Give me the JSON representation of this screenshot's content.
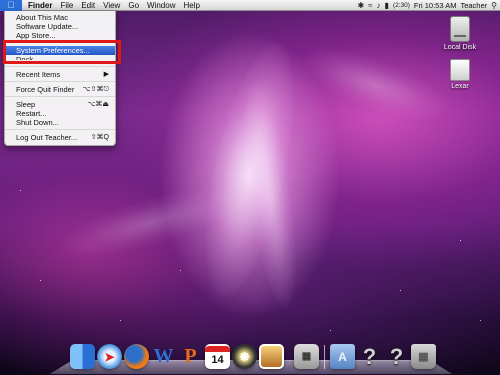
{
  "menubar": {
    "apple_icon": "apple-icon",
    "items": [
      "Finder",
      "File",
      "Edit",
      "View",
      "Go",
      "Window",
      "Help"
    ],
    "status": {
      "battery": "(2:30)",
      "clock": "Fri 10:53 AM",
      "user": "Teacher",
      "icons": [
        "bluetooth-icon",
        "wifi-icon",
        "volume-icon",
        "battery-icon",
        "spotlight-icon"
      ]
    }
  },
  "apple_menu": {
    "about": "About This Mac",
    "software_update": "Software Update...",
    "app_store": "App Store...",
    "system_preferences": "System Preferences...",
    "dock": "Dock",
    "recent_items": "Recent Items",
    "recent_items_arrow": "▶",
    "force_quit": "Force Quit Finder",
    "force_quit_shortcut": "⌥⇧⌘⎋",
    "sleep": "Sleep",
    "sleep_shortcut": "⌥⌘⏏",
    "restart": "Restart...",
    "shutdown": "Shut Down...",
    "logout": "Log Out Teacher...",
    "logout_shortcut": "⇧⌘Q"
  },
  "annotation": {
    "color": "#e01818"
  },
  "desktop_icons": {
    "local_disk": "Local Disk",
    "lexar": "Lexar"
  },
  "dock": {
    "calendar_date": "14",
    "items": [
      "finder-icon",
      "safari-icon",
      "firefox-icon",
      "word-icon",
      "powerpoint-icon",
      "ical-icon",
      "aperture-icon",
      "iphoto-icon",
      "calculator-icon",
      "applications-folder-icon",
      "question-mark-icon",
      "question-mark-icon",
      "trash-icon"
    ]
  }
}
